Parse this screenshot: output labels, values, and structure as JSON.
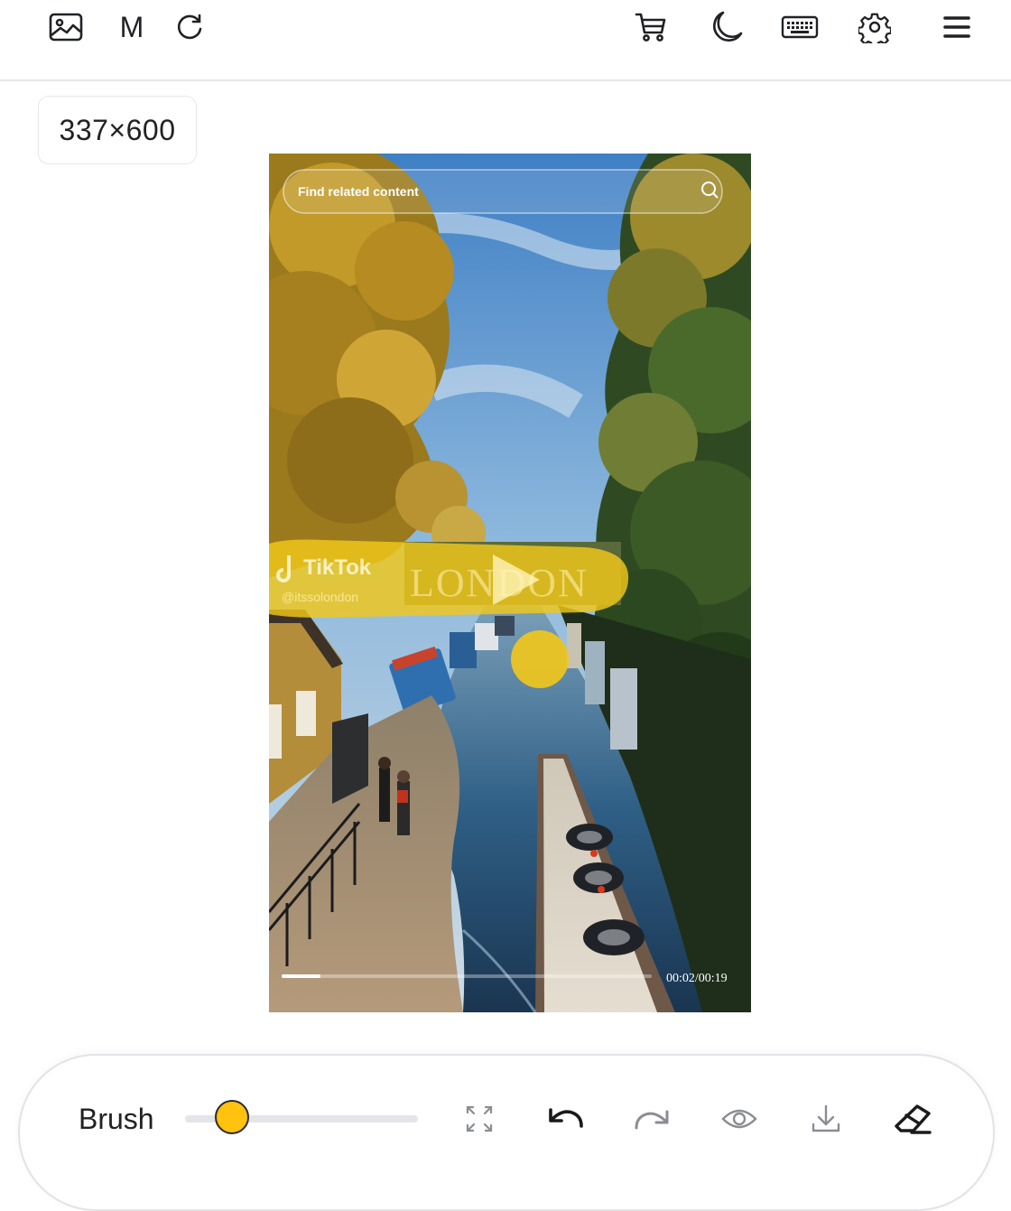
{
  "topbar": {
    "left_icons": [
      "image-icon",
      "m-icon",
      "refresh-icon"
    ],
    "m_label": "M",
    "right_icons": [
      "cart-icon",
      "moon-icon",
      "keyboard-icon",
      "gear-icon",
      "menu-icon"
    ]
  },
  "image_size_badge": "337×600",
  "video": {
    "search_placeholder": "Find related content",
    "brand": "TikTok",
    "handle": "@itssolondon",
    "overlay_word": "LONDON",
    "timecode": "00:02/00:19",
    "progress": 0.105
  },
  "toolbar": {
    "brush_label": "Brush",
    "brush_size": 0.2,
    "icons": [
      "fullscreen-icon",
      "undo-icon",
      "redo-icon",
      "eye-icon",
      "download-icon",
      "eraser-icon"
    ]
  },
  "colors": {
    "accent": "#ffc20e",
    "mask": "#f2c81a",
    "icon": "#1f2125",
    "icon_muted": "#8a8d93"
  }
}
